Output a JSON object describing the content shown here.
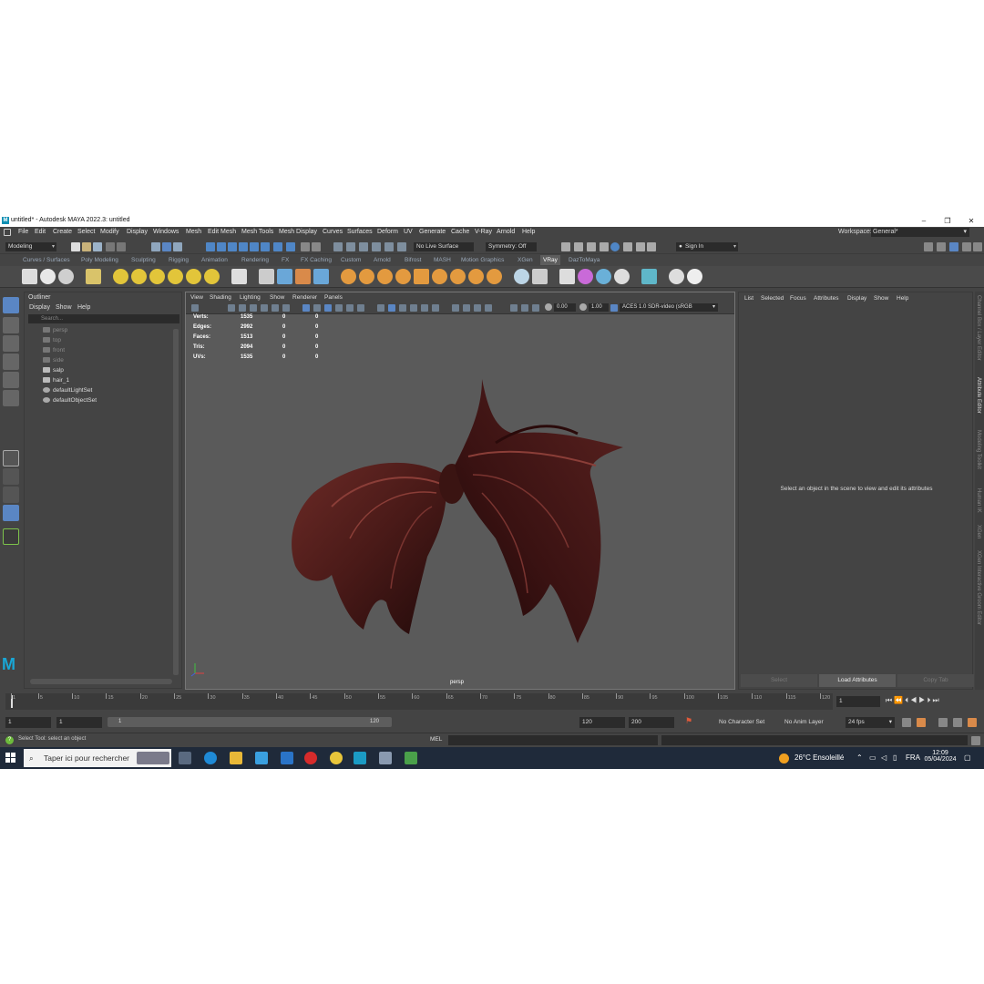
{
  "window": {
    "title": "untitled* - Autodesk MAYA 2022.3: untitled",
    "logo": "M",
    "min": "–",
    "max": "❐",
    "close": "✕"
  },
  "menubar": {
    "items": [
      "File",
      "Edit",
      "Create",
      "Select",
      "Modify",
      "Display",
      "Windows",
      "Mesh",
      "Edit Mesh",
      "Mesh Tools",
      "Mesh Display",
      "Curves",
      "Surfaces",
      "Deform",
      "UV",
      "Generate",
      "Cache",
      "V-Ray",
      "Arnold",
      "Help"
    ],
    "workspace_label": "Workspace:",
    "workspace_value": "General*"
  },
  "statusline": {
    "mode": "Modeling",
    "live_surface": "No Live Surface",
    "symmetry": "Symmetry: Off",
    "sign_in": "Sign In"
  },
  "shelf": {
    "tabs": [
      "Curves / Surfaces",
      "Poly Modeling",
      "Sculpting",
      "Rigging",
      "Animation",
      "Rendering",
      "FX",
      "FX Caching",
      "Custom",
      "Arnold",
      "Bifrost",
      "MASH",
      "Motion Graphics",
      "XGen",
      "VRay",
      "DazToMaya"
    ],
    "active_tab": "VRay"
  },
  "outliner": {
    "title": "Outliner",
    "menu": [
      "Display",
      "Show",
      "Help"
    ],
    "search_placeholder": "Search...",
    "items": [
      {
        "label": "persp",
        "dim": true
      },
      {
        "label": "top",
        "dim": true
      },
      {
        "label": "front",
        "dim": true
      },
      {
        "label": "side",
        "dim": true
      },
      {
        "label": "salp",
        "dim": false
      },
      {
        "label": "hair_1",
        "dim": false
      },
      {
        "label": "defaultLightSet",
        "dim": false
      },
      {
        "label": "defaultObjectSet",
        "dim": false
      }
    ]
  },
  "viewport": {
    "menu": [
      "View",
      "Shading",
      "Lighting",
      "Show",
      "Renderer",
      "Panels"
    ],
    "exposure": "0.00",
    "gamma": "1.00",
    "color_space": "ACES 1.0 SDR-video (sRGB",
    "camera": "persp",
    "hud": [
      {
        "label": "Verts:",
        "v1": "1535",
        "v2": "0",
        "v3": "0"
      },
      {
        "label": "Edges:",
        "v1": "2992",
        "v2": "0",
        "v3": "0"
      },
      {
        "label": "Faces:",
        "v1": "1513",
        "v2": "0",
        "v3": "0"
      },
      {
        "label": "Tris:",
        "v1": "2094",
        "v2": "0",
        "v3": "0"
      },
      {
        "label": "UVs:",
        "v1": "1535",
        "v2": "0",
        "v3": "0"
      }
    ]
  },
  "attribute_editor": {
    "menu": [
      "List",
      "Selected",
      "Focus",
      "Attributes",
      "Display",
      "Show",
      "Help"
    ],
    "message": "Select an object in the scene to view and edit its attributes",
    "buttons": [
      "Select",
      "Load Attributes",
      "Copy Tab"
    ],
    "side_tabs": [
      "Channel Box / Layer Editor",
      "Attribute Editor",
      "Modeling Toolkit",
      "Human IK",
      "XGen",
      "XGen Interactive Groom Editor"
    ]
  },
  "timeslider": {
    "ticks": [
      "1",
      "5",
      "10",
      "15",
      "20",
      "25",
      "30",
      "35",
      "40",
      "45",
      "50",
      "55",
      "60",
      "65",
      "70",
      "75",
      "80",
      "85",
      "90",
      "95",
      "100",
      "105",
      "110",
      "115",
      "120"
    ],
    "current_frame": "1"
  },
  "range": {
    "start": "1",
    "anim_start": "1",
    "slider_start": "1",
    "slider_end": "120",
    "anim_end": "120",
    "end": "200",
    "character_set": "No Character Set",
    "anim_layer": "No Anim Layer",
    "fps": "24 fps"
  },
  "commandline": {
    "help_text": "Select Tool: select an object",
    "lang": "MEL"
  },
  "taskbar": {
    "search_placeholder": "Taper ici pour rechercher",
    "weather": "26°C  Ensoleillé",
    "lang": "FRA",
    "time": "12:09",
    "date": "05/04/2024"
  }
}
